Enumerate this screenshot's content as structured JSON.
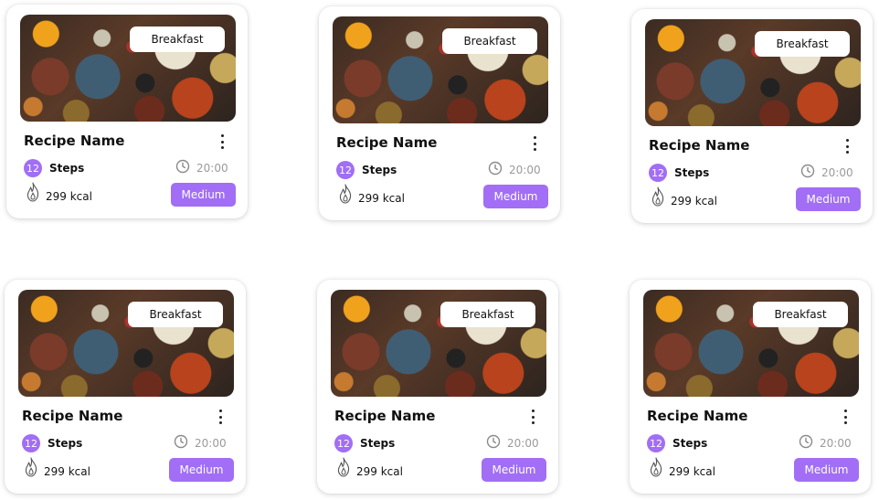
{
  "cards": [
    {
      "category": "Breakfast",
      "name": "Recipe Name",
      "steps_count": "12",
      "steps_label": "Steps",
      "time": "20:00",
      "calories": "299 kcal",
      "difficulty": "Medium"
    },
    {
      "category": "Breakfast",
      "name": "Recipe Name",
      "steps_count": "12",
      "steps_label": "Steps",
      "time": "20:00",
      "calories": "299 kcal",
      "difficulty": "Medium"
    },
    {
      "category": "Breakfast",
      "name": "Recipe Name",
      "steps_count": "12",
      "steps_label": "Steps",
      "time": "20:00",
      "calories": "299 kcal",
      "difficulty": "Medium"
    },
    {
      "category": "Breakfast",
      "name": "Recipe Name",
      "steps_count": "12",
      "steps_label": "Steps",
      "time": "20:00",
      "calories": "299 kcal",
      "difficulty": "Medium"
    },
    {
      "category": "Breakfast",
      "name": "Recipe Name",
      "steps_count": "12",
      "steps_label": "Steps",
      "time": "20:00",
      "calories": "299 kcal",
      "difficulty": "Medium"
    },
    {
      "category": "Breakfast",
      "name": "Recipe Name",
      "steps_count": "12",
      "steps_label": "Steps",
      "time": "20:00",
      "calories": "299 kcal",
      "difficulty": "Medium"
    }
  ],
  "colors": {
    "accent": "#a16ef5",
    "muted_text": "#9a9a9a",
    "card_bg": "#ffffff"
  },
  "icons": {
    "menu": "more-vertical-icon",
    "time": "clock-icon",
    "calories": "flame-icon"
  }
}
